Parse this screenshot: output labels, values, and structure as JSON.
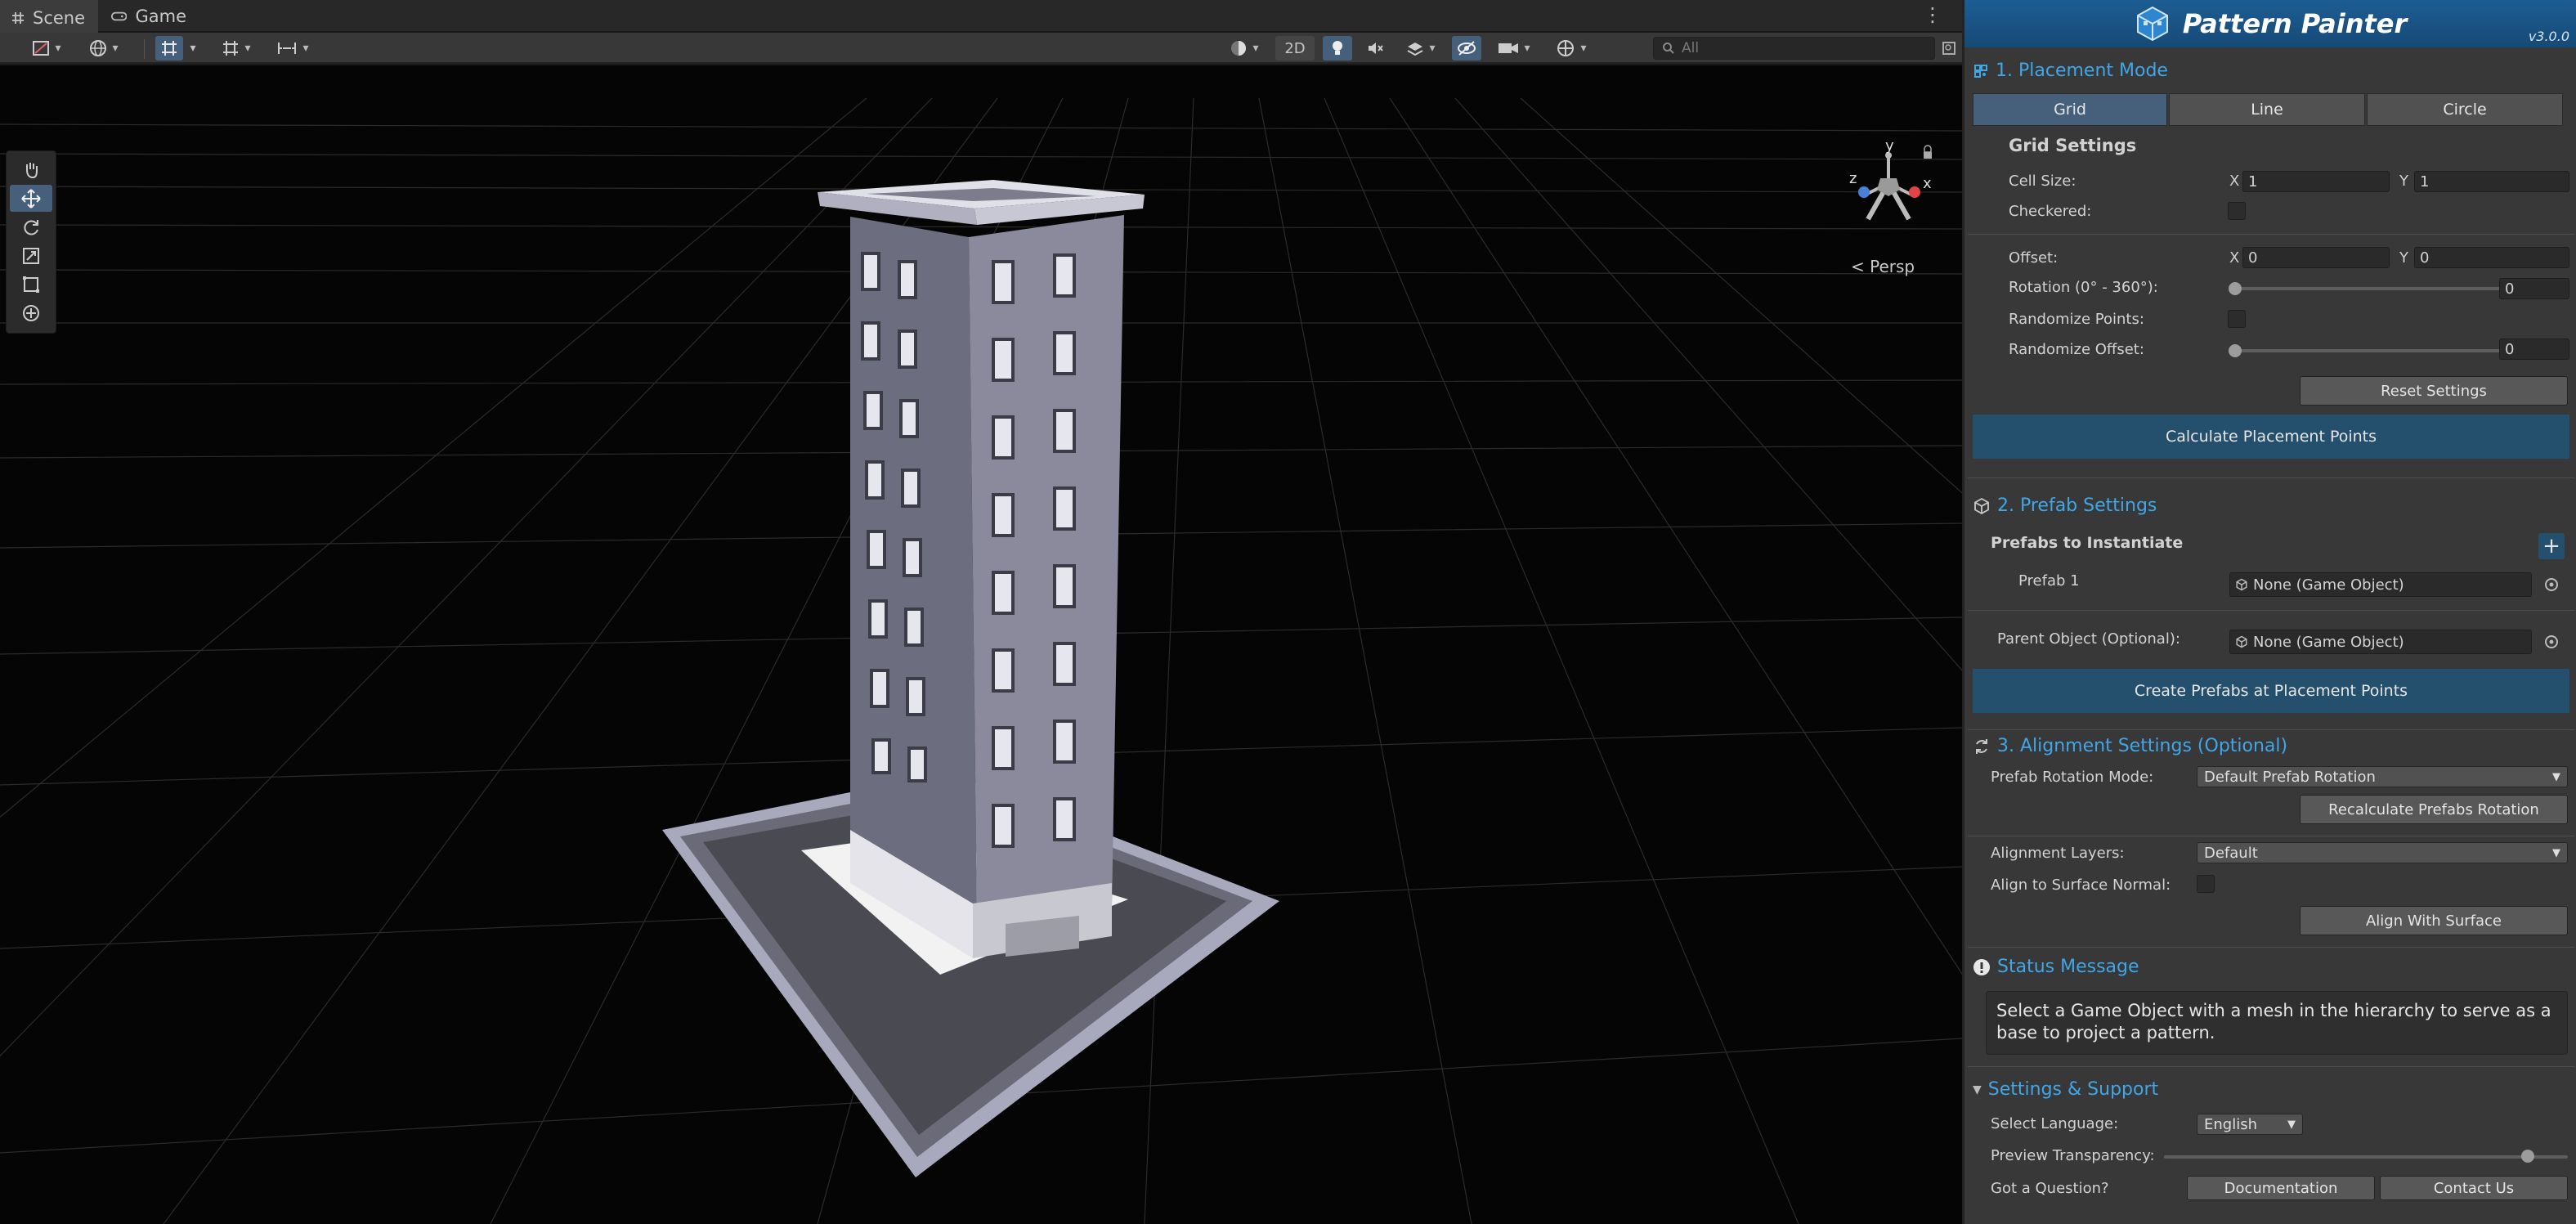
{
  "scene_window": {
    "tabs": [
      {
        "label": "Scene",
        "icon": "hash-grid-icon"
      },
      {
        "label": "Game",
        "icon": "gamepad-icon"
      }
    ],
    "toolbar": {
      "toggle_2d": "2D",
      "search_placeholder": "All"
    },
    "view_mode": "Persp",
    "gizmo_axes": {
      "y": "y",
      "x": "x",
      "z": "z"
    },
    "tools": [
      "hand-tool-icon",
      "move-tool-icon",
      "rotate-tool-icon",
      "scale-tool-icon",
      "rect-tool-icon",
      "transform-tool-icon"
    ],
    "active_tool": "move-tool-icon"
  },
  "panel": {
    "title": "Pattern Painter",
    "version": "v3.0.0",
    "placement": {
      "heading": "1. Placement Mode",
      "modes": [
        "Grid",
        "Line",
        "Circle"
      ],
      "active_mode": "Grid",
      "grid_settings_title": "Grid Settings",
      "cell_size_label": "Cell Size:",
      "cell_size": {
        "x_label": "X",
        "x": "1",
        "y_label": "Y",
        "y": "1"
      },
      "checkered_label": "Checkered:",
      "offset_label": "Offset:",
      "offset": {
        "x_label": "X",
        "x": "0",
        "y_label": "Y",
        "y": "0"
      },
      "rotation_label": "Rotation (0° - 360°):",
      "rotation_value": "0",
      "randomize_points_label": "Randomize Points:",
      "randomize_offset_label": "Randomize Offset:",
      "randomize_offset_value": "0",
      "reset_button": "Reset Settings",
      "calculate_button": "Calculate Placement Points"
    },
    "prefab": {
      "heading": "2. Prefab Settings",
      "prefabs_title": "Prefabs to Instantiate",
      "add_button": "+",
      "prefab1_label": "Prefab 1",
      "prefab1_value": "None (Game Object)",
      "parent_label": "Parent Object (Optional):",
      "parent_value": "None (Game Object)",
      "create_button": "Create Prefabs at Placement Points"
    },
    "alignment": {
      "heading": "3. Alignment Settings (Optional)",
      "rotation_mode_label": "Prefab Rotation Mode:",
      "rotation_mode_value": "Default Prefab Rotation",
      "recalculate_button": "Recalculate Prefabs Rotation",
      "layers_label": "Alignment Layers:",
      "layers_value": "Default",
      "surface_normal_label": "Align to Surface Normal:",
      "align_button": "Align With Surface"
    },
    "status": {
      "heading": "Status Message",
      "message": "Select a Game Object with a mesh in the hierarchy to serve as a base to project a pattern."
    },
    "settings": {
      "heading": "Settings & Support",
      "language_label": "Select Language:",
      "language_value": "English",
      "transparency_label": "Preview Transparency:",
      "transparency_value": 0.9,
      "question_label": "Got a Question?",
      "documentation_button": "Documentation",
      "contact_button": "Contact Us"
    },
    "colors": {
      "accent": "#3fa6e8",
      "banner": "#1d5d93",
      "active": "#46607c",
      "action": "#25506d"
    }
  }
}
